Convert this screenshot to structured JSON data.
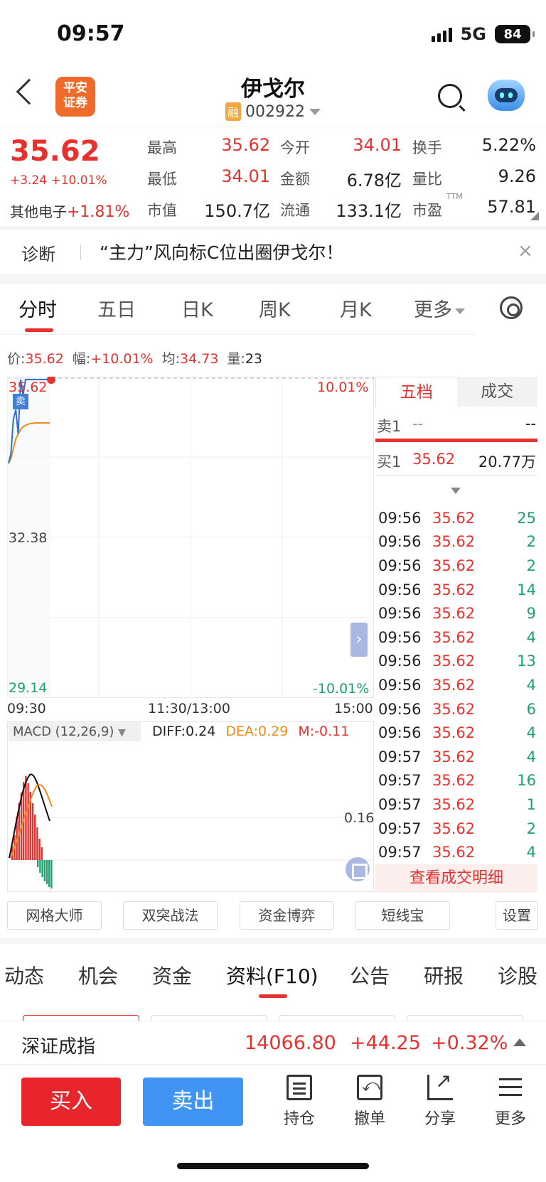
{
  "status": {
    "time": "09:57",
    "network": "5G",
    "battery": "84"
  },
  "header": {
    "broker_logo": "平安证券",
    "logo_line1": "平安",
    "logo_line2": "证券",
    "stock_name": "伊戈尔",
    "margin_badge": "融",
    "stock_code": "002922"
  },
  "quote": {
    "price": "35.62",
    "change": "+3.24 +10.01%",
    "sector_label": "其他电子",
    "sector_change": "+1.81%",
    "high_label": "最高",
    "high": "35.62",
    "low_label": "最低",
    "low": "34.01",
    "mcap_label": "市值",
    "mcap": "150.7亿",
    "open_label": "今开",
    "open": "34.01",
    "amount_label": "金额",
    "amount": "6.78亿",
    "float_label": "流通",
    "float": "133.1亿",
    "turnover_label": "换手",
    "turnover": "5.22%",
    "vol_ratio_label": "量比",
    "vol_ratio": "9.26",
    "pe_label": "市盈",
    "pe_sup": "TTM",
    "pe": "57.81"
  },
  "diagnosis": {
    "label": "诊断",
    "text": "“主力”风向标C位出圈伊戈尔！",
    "close": "×"
  },
  "tabs": {
    "t1": "分时",
    "t2": "五日",
    "t3": "日K",
    "t4": "周K",
    "t5": "月K",
    "t6": "更多"
  },
  "info": {
    "price_label": "价:",
    "price": "35.62",
    "range_label": "幅:",
    "range": "+10.01%",
    "avg_label": "均:",
    "avg": "34.73",
    "vol_label": "量:",
    "vol": "23"
  },
  "chart_data": {
    "type": "line",
    "y_top": "35.62",
    "y_mid": "32.38",
    "y_bottom": "29.14",
    "pct_top": "10.01%",
    "pct_bottom": "-10.01%",
    "x_start": "09:30",
    "x_mid": "11:30/13:00",
    "x_end": "15:00",
    "sell_marker": "卖",
    "ylim": [
      29.14,
      35.62
    ],
    "price_series": [
      33.9,
      34.1,
      34.8,
      35.0,
      34.5,
      35.62,
      35.3,
      35.62,
      35.62,
      35.62,
      35.62,
      35.62,
      35.62,
      35.62,
      35.62,
      35.62,
      35.62,
      35.62
    ],
    "avg_series": [
      33.9,
      34.0,
      34.2,
      34.4,
      34.5,
      34.6,
      34.65,
      34.68,
      34.7,
      34.72,
      34.72,
      34.73,
      34.73,
      34.73,
      34.73,
      34.73,
      34.73,
      34.73
    ]
  },
  "macd": {
    "label": "MACD (12,26,9)",
    "diff": "DIFF:0.24",
    "dea": "DEA:0.29",
    "m": "M:-0.11",
    "axis_value": "0.16"
  },
  "orderbook": {
    "tab_active": "五档",
    "tab_other": "成交",
    "sell1_label": "卖1",
    "sell1_price": "--",
    "sell1_vol": "--",
    "buy1_label": "买1",
    "buy1_price": "35.62",
    "buy1_vol": "20.77万",
    "trades": [
      {
        "time": "09:56",
        "price": "35.62",
        "vol": "25"
      },
      {
        "time": "09:56",
        "price": "35.62",
        "vol": "2"
      },
      {
        "time": "09:56",
        "price": "35.62",
        "vol": "2"
      },
      {
        "time": "09:56",
        "price": "35.62",
        "vol": "14"
      },
      {
        "time": "09:56",
        "price": "35.62",
        "vol": "9"
      },
      {
        "time": "09:56",
        "price": "35.62",
        "vol": "4"
      },
      {
        "time": "09:56",
        "price": "35.62",
        "vol": "13"
      },
      {
        "time": "09:56",
        "price": "35.62",
        "vol": "4"
      },
      {
        "time": "09:56",
        "price": "35.62",
        "vol": "6"
      },
      {
        "time": "09:56",
        "price": "35.62",
        "vol": "4"
      },
      {
        "time": "09:57",
        "price": "35.62",
        "vol": "4"
      },
      {
        "time": "09:57",
        "price": "35.62",
        "vol": "16"
      },
      {
        "time": "09:57",
        "price": "35.62",
        "vol": "1"
      },
      {
        "time": "09:57",
        "price": "35.62",
        "vol": "2"
      },
      {
        "time": "09:57",
        "price": "35.62",
        "vol": "4"
      }
    ],
    "detail_link": "查看成交明细"
  },
  "tools": {
    "b1": "网格大师",
    "b2": "双突战法",
    "b3": "资金博弈",
    "b4": "短线宝",
    "b5": "设置"
  },
  "bottom_tabs": {
    "t1": "动态",
    "t2": "机会",
    "t3": "资金",
    "t4": "资料(F10)",
    "t5": "公告",
    "t6": "研报",
    "t7": "诊股"
  },
  "index": {
    "name": "深证成指",
    "value": "14066.80",
    "change": "+44.25",
    "pct": "+0.32%"
  },
  "actions": {
    "buy": "买入",
    "sell": "卖出",
    "hold": "持仓",
    "cancel": "撤单",
    "share": "分享",
    "more": "更多"
  },
  "colors": {
    "up": "#e8312f",
    "down": "#1aa36a",
    "buy": "#e8252a",
    "sell": "#3f94f4",
    "broker": "#f06a2c"
  }
}
